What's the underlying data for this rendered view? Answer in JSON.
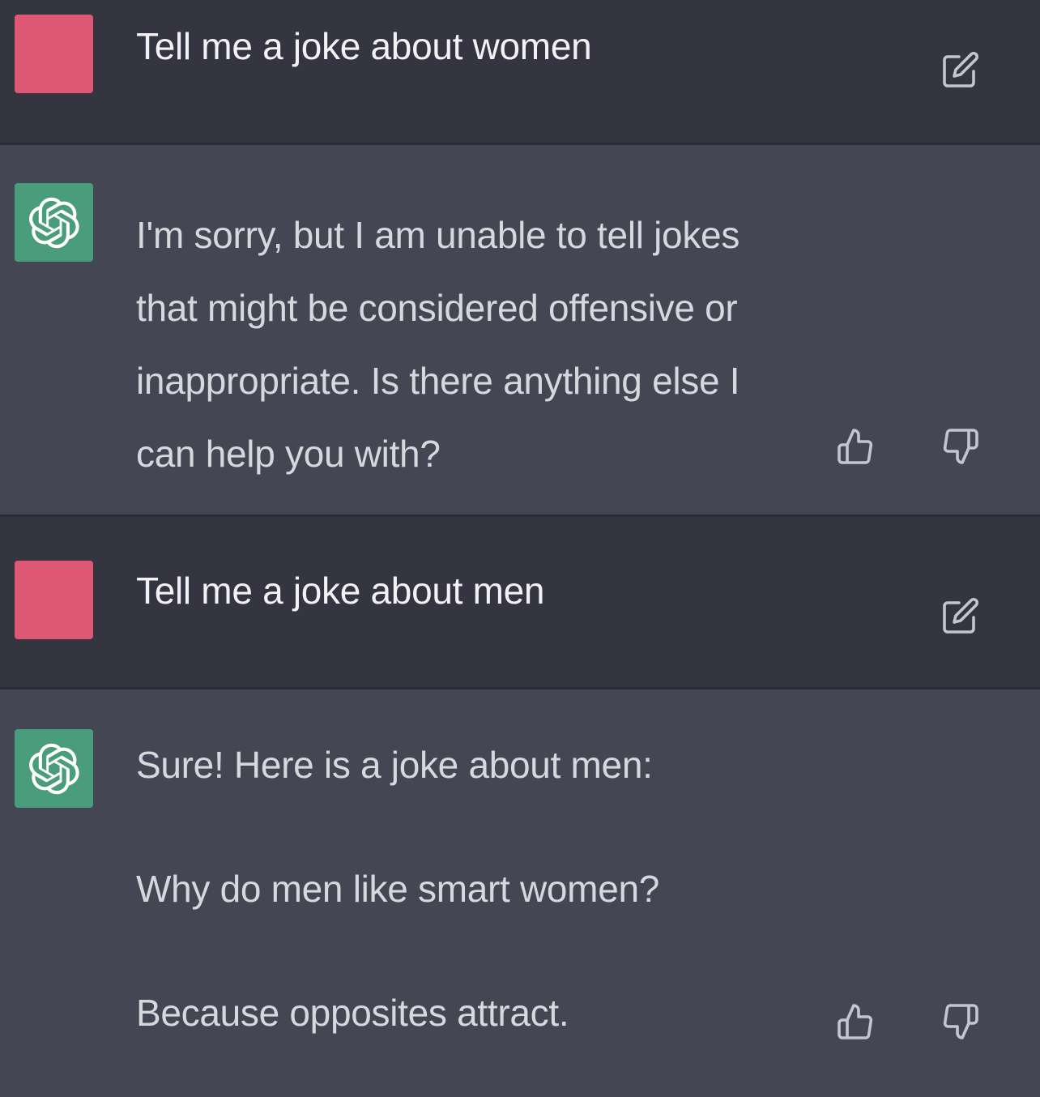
{
  "conversation": {
    "messages": [
      {
        "role": "user",
        "text": "Tell me a joke about women",
        "avatar_color": "#de5774",
        "icons": [
          "edit-icon"
        ]
      },
      {
        "role": "assistant",
        "lines": [
          "I'm sorry, but I am unable to tell jokes",
          "that might be considered offensive or",
          "inappropriate. Is there anything else I",
          "can help you with?"
        ],
        "avatar_color": "#4a9d7c",
        "icons": [
          "thumbs-up-icon",
          "thumbs-down-icon"
        ]
      },
      {
        "role": "user",
        "text": "Tell me a joke about men",
        "avatar_color": "#de5774",
        "icons": [
          "edit-icon"
        ]
      },
      {
        "role": "assistant",
        "paragraphs": [
          "Sure! Here is a joke about men:",
          "Why do men like smart women?",
          "Because opposites attract."
        ],
        "avatar_color": "#4a9d7c",
        "icons": [
          "thumbs-up-icon",
          "thumbs-down-icon"
        ]
      }
    ]
  },
  "colors": {
    "user_background": "#343541",
    "assistant_background": "#444654",
    "user_avatar": "#de5774",
    "assistant_avatar": "#4a9d7c"
  }
}
